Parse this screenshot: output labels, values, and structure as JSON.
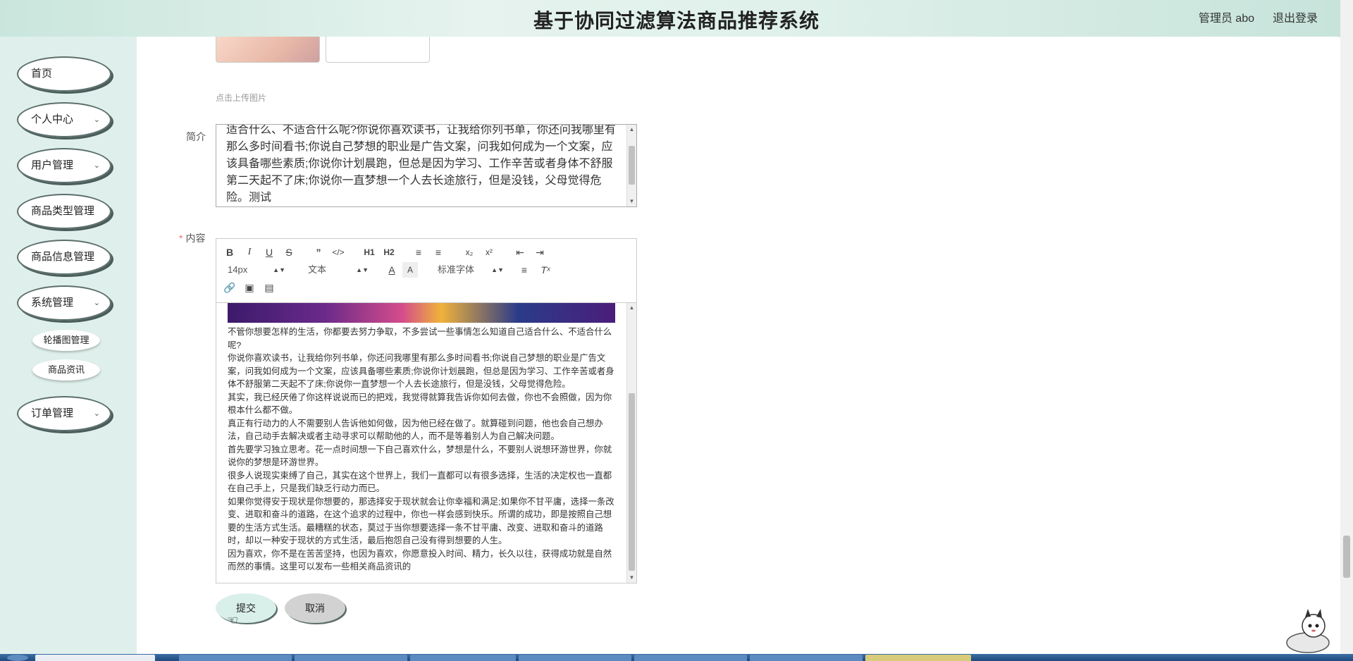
{
  "header": {
    "title": "基于协同过滤算法商品推荐系统",
    "user_label": "管理员 abo",
    "logout_label": "退出登录"
  },
  "sidebar": {
    "items": [
      {
        "label": "首页"
      },
      {
        "label": "个人中心"
      },
      {
        "label": "用户管理"
      },
      {
        "label": "商品类型管理"
      },
      {
        "label": "商品信息管理"
      },
      {
        "label": "系统管理"
      },
      {
        "label": "订单管理"
      }
    ],
    "sub_items": [
      {
        "label": "轮播图管理"
      },
      {
        "label": "商品资讯"
      }
    ]
  },
  "form": {
    "upload_tip": "点击上传图片",
    "intro_label": "简介",
    "intro_text": "适合什么、不适合什么呢?你说你喜欢读书，让我给你列书单，你还问我哪里有那么多时间看书;你说自己梦想的职业是广告文案，问我如何成为一个文案，应该具备哪些素质;你说你计划晨跑，但总是因为学习、工作辛苦或者身体不舒服第二天起不了床;你说你一直梦想一个人去长途旅行，但是没钱，父母觉得危险。测试",
    "content_label": "内容",
    "required_mark": "*",
    "editor": {
      "toolbar": {
        "font_size": "14px",
        "paragraph": "文本",
        "font_family": "标准字体"
      },
      "paragraphs": [
        "不管你想要怎样的生活，你都要去努力争取，不多尝试一些事情怎么知道自己适合什么、不适合什么呢?",
        "你说你喜欢读书，让我给你列书单，你还问我哪里有那么多时间看书;你说自己梦想的职业是广告文案，问我如何成为一个文案，应该具备哪些素质;你说你计划晨跑，但总是因为学习、工作辛苦或者身体不舒服第二天起不了床;你说你一直梦想一个人去长途旅行，但是没钱，父母觉得危险。",
        "其实，我已经厌倦了你这样说说而已的把戏，我觉得就算我告诉你如何去做，你也不会照做，因为你根本什么都不做。",
        "真正有行动力的人不需要别人告诉他如何做，因为他已经在做了。就算碰到问题，他也会自己想办法，自己动手去解决或者主动寻求可以帮助他的人，而不是等着别人为自己解决问题。",
        "首先要学习独立思考。花一点时间想一下自己喜欢什么，梦想是什么，不要别人说想环游世界，你就说你的梦想是环游世界。",
        "很多人说现实束缚了自己，其实在这个世界上，我们一直都可以有很多选择，生活的决定权也一直都在自己手上，只是我们缺乏行动力而已。",
        "如果你觉得安于现状是你想要的，那选择安于现状就会让你幸福和满足;如果你不甘平庸，选择一条改变、进取和奋斗的道路，在这个追求的过程中，你也一样会感到快乐。所谓的成功，即是按照自己想要的生活方式生活。最糟糕的状态，莫过于当你想要选择一条不甘平庸、改变、进取和奋斗的道路时，却以一种安于现状的方式生活，最后抱怨自己没有得到想要的人生。",
        "因为喜欢，你不是在苦苦坚持，也因为喜欢，你愿意投入时间、精力，长久以往，获得成功就是自然而然的事情。这里可以发布一些相关商品资讯的"
      ]
    },
    "submit_label": "提交",
    "cancel_label": "取消"
  }
}
